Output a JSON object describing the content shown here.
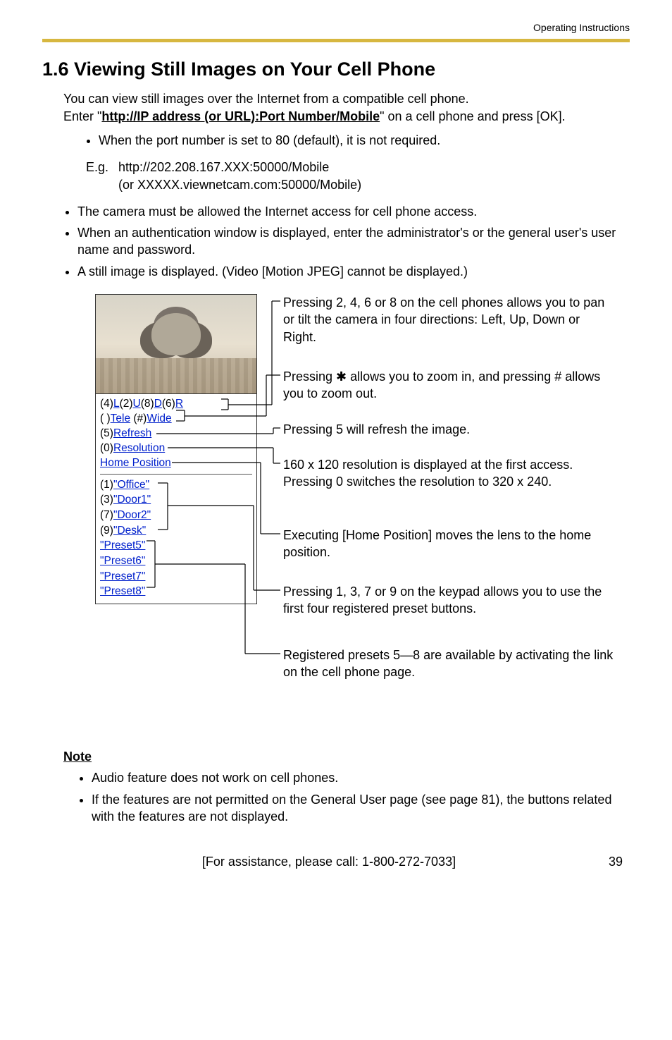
{
  "header": {
    "doc_type": "Operating Instructions"
  },
  "title": "1.6   Viewing Still Images on Your Cell Phone",
  "intro": {
    "p1a": "You can view still images over the Internet from a compatible cell phone.",
    "p2a": "Enter \"",
    "url": "http://IP address (or URL):Port Number/Mobile",
    "p2b": "\" on a cell phone and press [OK].",
    "bullet1": "When the port number is set to 80 (default), it is not required.",
    "eg_label": "E.g.",
    "eg_line1": "http://202.208.167.XXX:50000/Mobile",
    "eg_line2": "(or XXXXX.viewnetcam.com:50000/Mobile)"
  },
  "outer_bullets": [
    "The camera must be allowed the Internet access for cell phone access.",
    "When an authentication window is displayed, enter the administrator's or the general user's user name and password.",
    "A still image is displayed. (Video [Motion JPEG] cannot be displayed.)"
  ],
  "phone": {
    "nav": {
      "p4": "(4)",
      "L": "L",
      "p2": "(2)",
      "U": "U",
      "p8": "(8)",
      "D": "D",
      "p6": "(6)",
      "R": "R"
    },
    "zoom": {
      "lp": "(  )",
      "tele": "Tele",
      "hash": " (#)",
      "wide": "Wide"
    },
    "refresh": {
      "p5": "(5)",
      "label": "Refresh"
    },
    "res": {
      "p0": "(0)",
      "label": "Resolution"
    },
    "home": "Home Position",
    "presets_num": [
      {
        "n": "(1)",
        "name": "\"Office\""
      },
      {
        "n": "(3)",
        "name": "\"Door1\""
      },
      {
        "n": "(7)",
        "name": "\"Door2\""
      },
      {
        "n": "(9)",
        "name": "\"Desk\""
      }
    ],
    "presets_rest": [
      "\"Preset5\"",
      "\"Preset6\"",
      "\"Preset7\"",
      "\"Preset8\""
    ]
  },
  "expl": {
    "pan": "Pressing 2, 4, 6 or 8 on the cell phones allows you to pan or tilt the camera in four directions: Left, Up, Down or Right.",
    "zoom": "Pressing ✱ allows you to zoom in, and pressing # allows you to zoom out.",
    "refresh": "Pressing 5 will refresh the image.",
    "res": "160 x 120 resolution is displayed at the first access. Pressing 0 switches the resolution to 320 x 240.",
    "home": "Executing [Home Position] moves the lens to the home position.",
    "preset14": "Pressing 1, 3, 7 or 9 on the keypad allows you to use the first four registered preset buttons.",
    "preset58": "Registered presets 5—8 are available by activating the link on the cell phone page."
  },
  "note": {
    "heading": "Note",
    "items": [
      "Audio feature does not work on cell phones.",
      "If the features are not permitted on the General User page (see page 81), the buttons related with the features are not displayed."
    ]
  },
  "footer": {
    "assist": "[For assistance, please call: 1-800-272-7033]",
    "page": "39"
  }
}
